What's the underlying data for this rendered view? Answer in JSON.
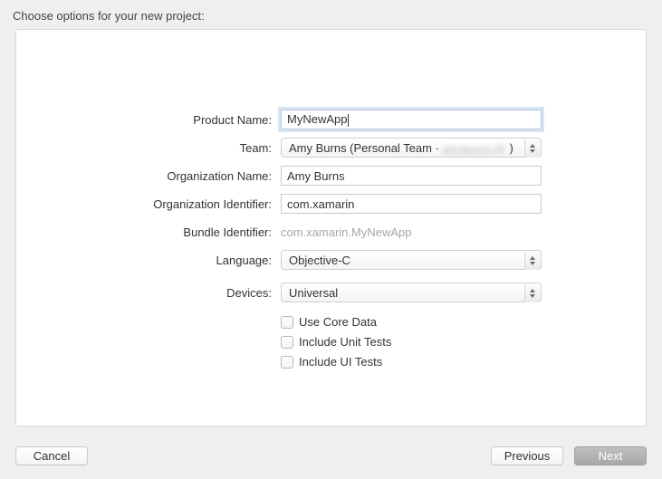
{
  "heading": "Choose options for your new project:",
  "form": {
    "productName": {
      "label": "Product Name:",
      "value": "MyNewApp"
    },
    "team": {
      "label": "Team:",
      "value_prefix": "Amy Burns (Personal Team · ",
      "value_obscured": "amyburns.@",
      "value_suffix": ")"
    },
    "orgName": {
      "label": "Organization Name:",
      "value": "Amy Burns"
    },
    "orgId": {
      "label": "Organization Identifier:",
      "value": "com.xamarin"
    },
    "bundleId": {
      "label": "Bundle Identifier:",
      "value": "com.xamarin.MyNewApp"
    },
    "language": {
      "label": "Language:",
      "value": "Objective-C"
    },
    "devices": {
      "label": "Devices:",
      "value": "Universal"
    },
    "useCoreData": {
      "label": "Use Core Data",
      "checked": false
    },
    "includeUnit": {
      "label": "Include Unit Tests",
      "checked": false
    },
    "includeUI": {
      "label": "Include UI Tests",
      "checked": false
    }
  },
  "buttons": {
    "cancel": "Cancel",
    "previous": "Previous",
    "next": "Next"
  }
}
